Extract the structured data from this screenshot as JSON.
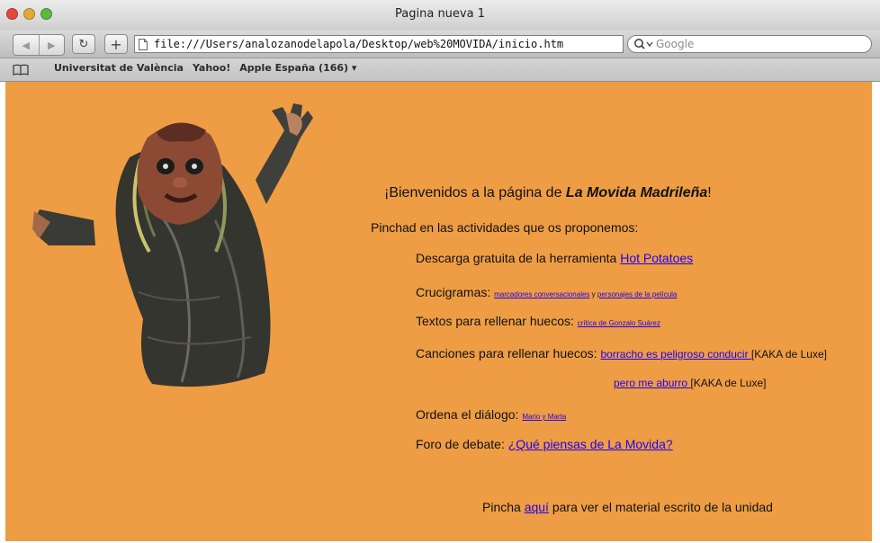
{
  "window": {
    "title": "Pagina nueva 1"
  },
  "toolbar": {
    "url": "file:///Users/analozanodelapola/Desktop/web%20MOVIDA/inicio.htm",
    "search_placeholder": "Google"
  },
  "bookmarks": [
    "Universitat de València",
    "Yahoo!",
    "Apple España (166) ▾"
  ],
  "page": {
    "welcome_prefix": "¡Bienvenidos a la página de ",
    "welcome_title": "La Movida Madrileña",
    "welcome_suffix": "!",
    "intro": "Pinchad en las actividades que os proponemos:",
    "descarga_label": "Descarga gratuita de la herramienta ",
    "descarga_link": "Hot Potatoes",
    "crucigramas_label": "Crucigramas: ",
    "crucigramas_link1": "marcadores conversacionales",
    "crucigramas_sep": " y ",
    "crucigramas_link2": "personajes de la película",
    "textos_label": "Textos para rellenar huecos: ",
    "textos_link": "crítica de Gonzalo Suárez",
    "canciones_label": "Canciones para rellenar huecos: ",
    "canciones_link1": "borracho es peligroso conducir ",
    "canciones_suffix1": "[KAKA de Luxe]",
    "canciones_link2": "pero me aburro ",
    "canciones_suffix2": "[KAKA de Luxe]",
    "ordena_label": "Ordena el diálogo: ",
    "ordena_link": "Mario y Marta",
    "foro_label": "Foro de debate: ",
    "foro_link": "¿Qué piensas de La Movida?",
    "footer_prefix": "Pincha ",
    "footer_link": "aquí",
    "footer_suffix": " para ver el material escrito de la unidad"
  },
  "colors": {
    "page_background": "#ee9d44",
    "link": "#2200ee"
  }
}
